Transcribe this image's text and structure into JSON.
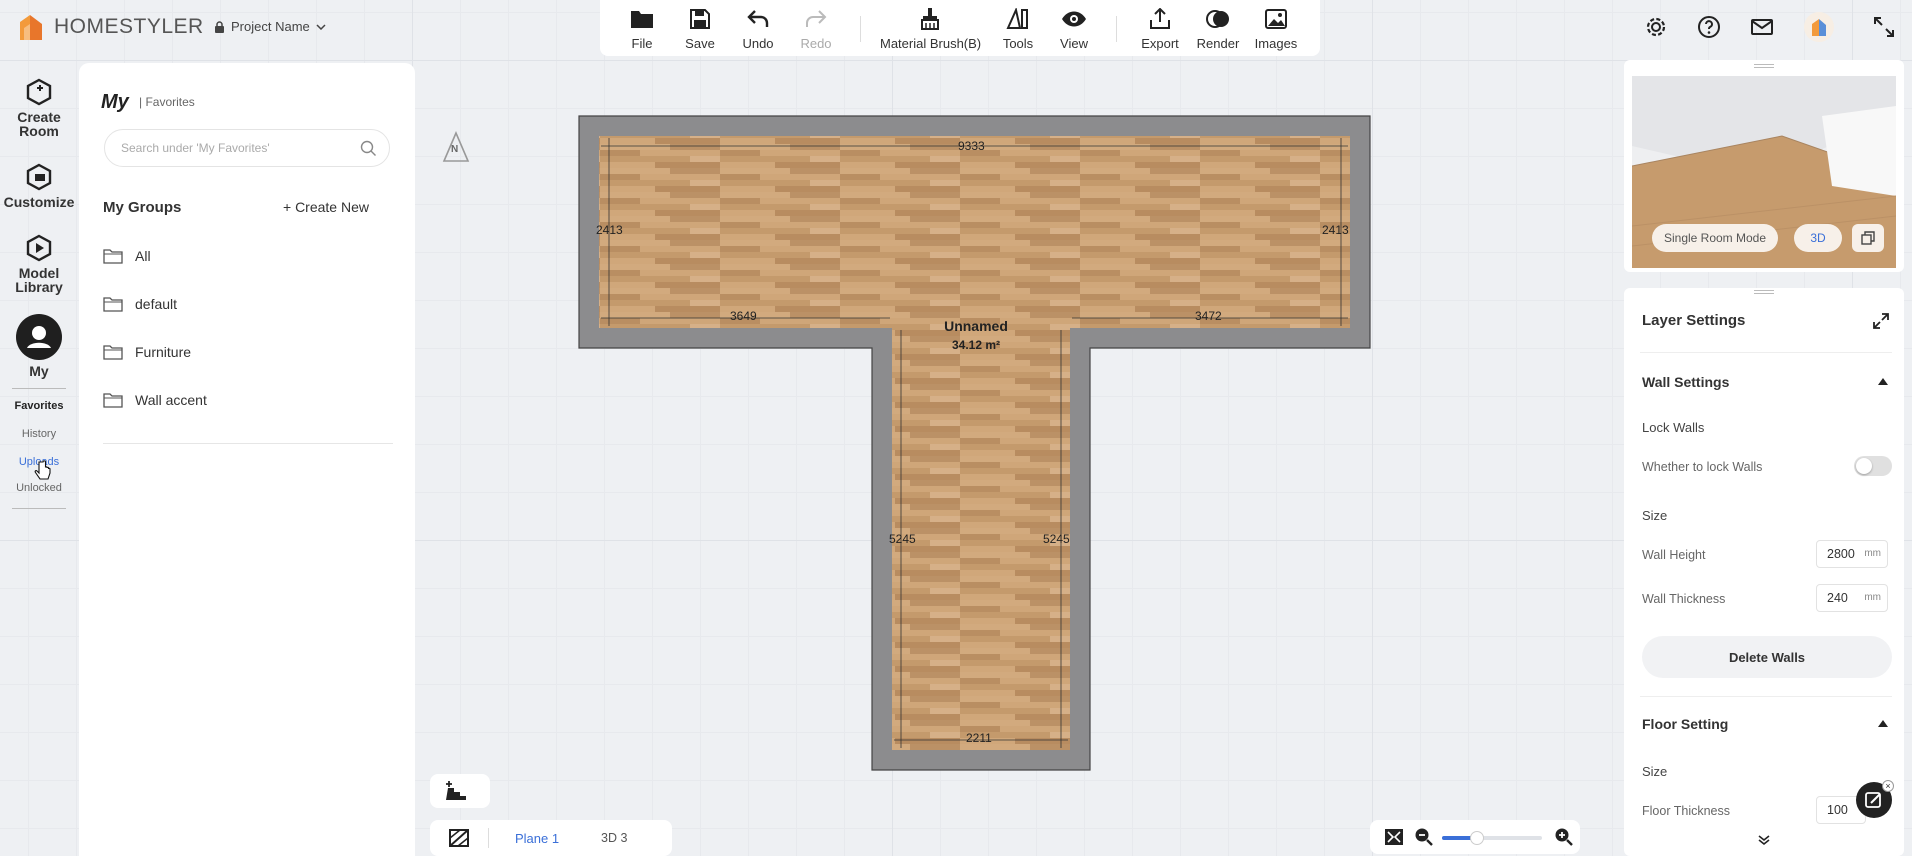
{
  "app": {
    "name": "HOMESTYLER",
    "project_name": "Project Name"
  },
  "rail": {
    "items": [
      {
        "label1": "Create",
        "label2": "Room"
      },
      {
        "label1": "Customize",
        "label2": ""
      },
      {
        "label1": "Model",
        "label2": "Library"
      },
      {
        "label1": "My",
        "label2": ""
      }
    ],
    "sub_items": [
      "Favorites",
      "History",
      "Uploads",
      "Unlocked"
    ]
  },
  "panel": {
    "title": "My",
    "subtitle": "| Favorites",
    "search_placeholder": "Search under 'My Favorites'",
    "groups_label": "My Groups",
    "create_new": "+ Create New",
    "groups": [
      "All",
      "default",
      "Furniture",
      "Wall accent"
    ]
  },
  "toolbar": {
    "items": [
      "File",
      "Save",
      "Undo",
      "Redo",
      "Material Brush(B)",
      "Tools",
      "View",
      "Export",
      "Render",
      "Images"
    ]
  },
  "canvas": {
    "compass": "N",
    "room_name": "Unnamed",
    "room_area": "34.12 m²",
    "dims": {
      "top": "9333",
      "left_arm": "2413",
      "right_arm": "2413",
      "lower_left": "3649",
      "lower_right": "3472",
      "stem_left": "5245",
      "stem_right": "5245",
      "bottom": "2211"
    }
  },
  "bottom": {
    "plane_label": "Plane 1",
    "view3d_label": "3D 3"
  },
  "preview": {
    "mode_button": "Single Room Mode",
    "view_button": "3D"
  },
  "settings": {
    "layer_settings": "Layer Settings",
    "wall_settings": "Wall Settings",
    "lock_walls": "Lock Walls",
    "lock_walls_desc": "Whether to lock Walls",
    "size_label": "Size",
    "wall_height_label": "Wall Height",
    "wall_height_value": "2800",
    "wall_thickness_label": "Wall Thickness",
    "wall_thickness_value": "240",
    "unit": "mm",
    "delete_walls": "Delete Walls",
    "floor_setting": "Floor Setting",
    "floor_size_label": "Size",
    "floor_thickness_label": "Floor Thickness",
    "floor_thickness_value": "100"
  },
  "colors": {
    "accent": "#3a6fd8",
    "wall": "#8c8c8e",
    "floor": "#c49a6c"
  }
}
